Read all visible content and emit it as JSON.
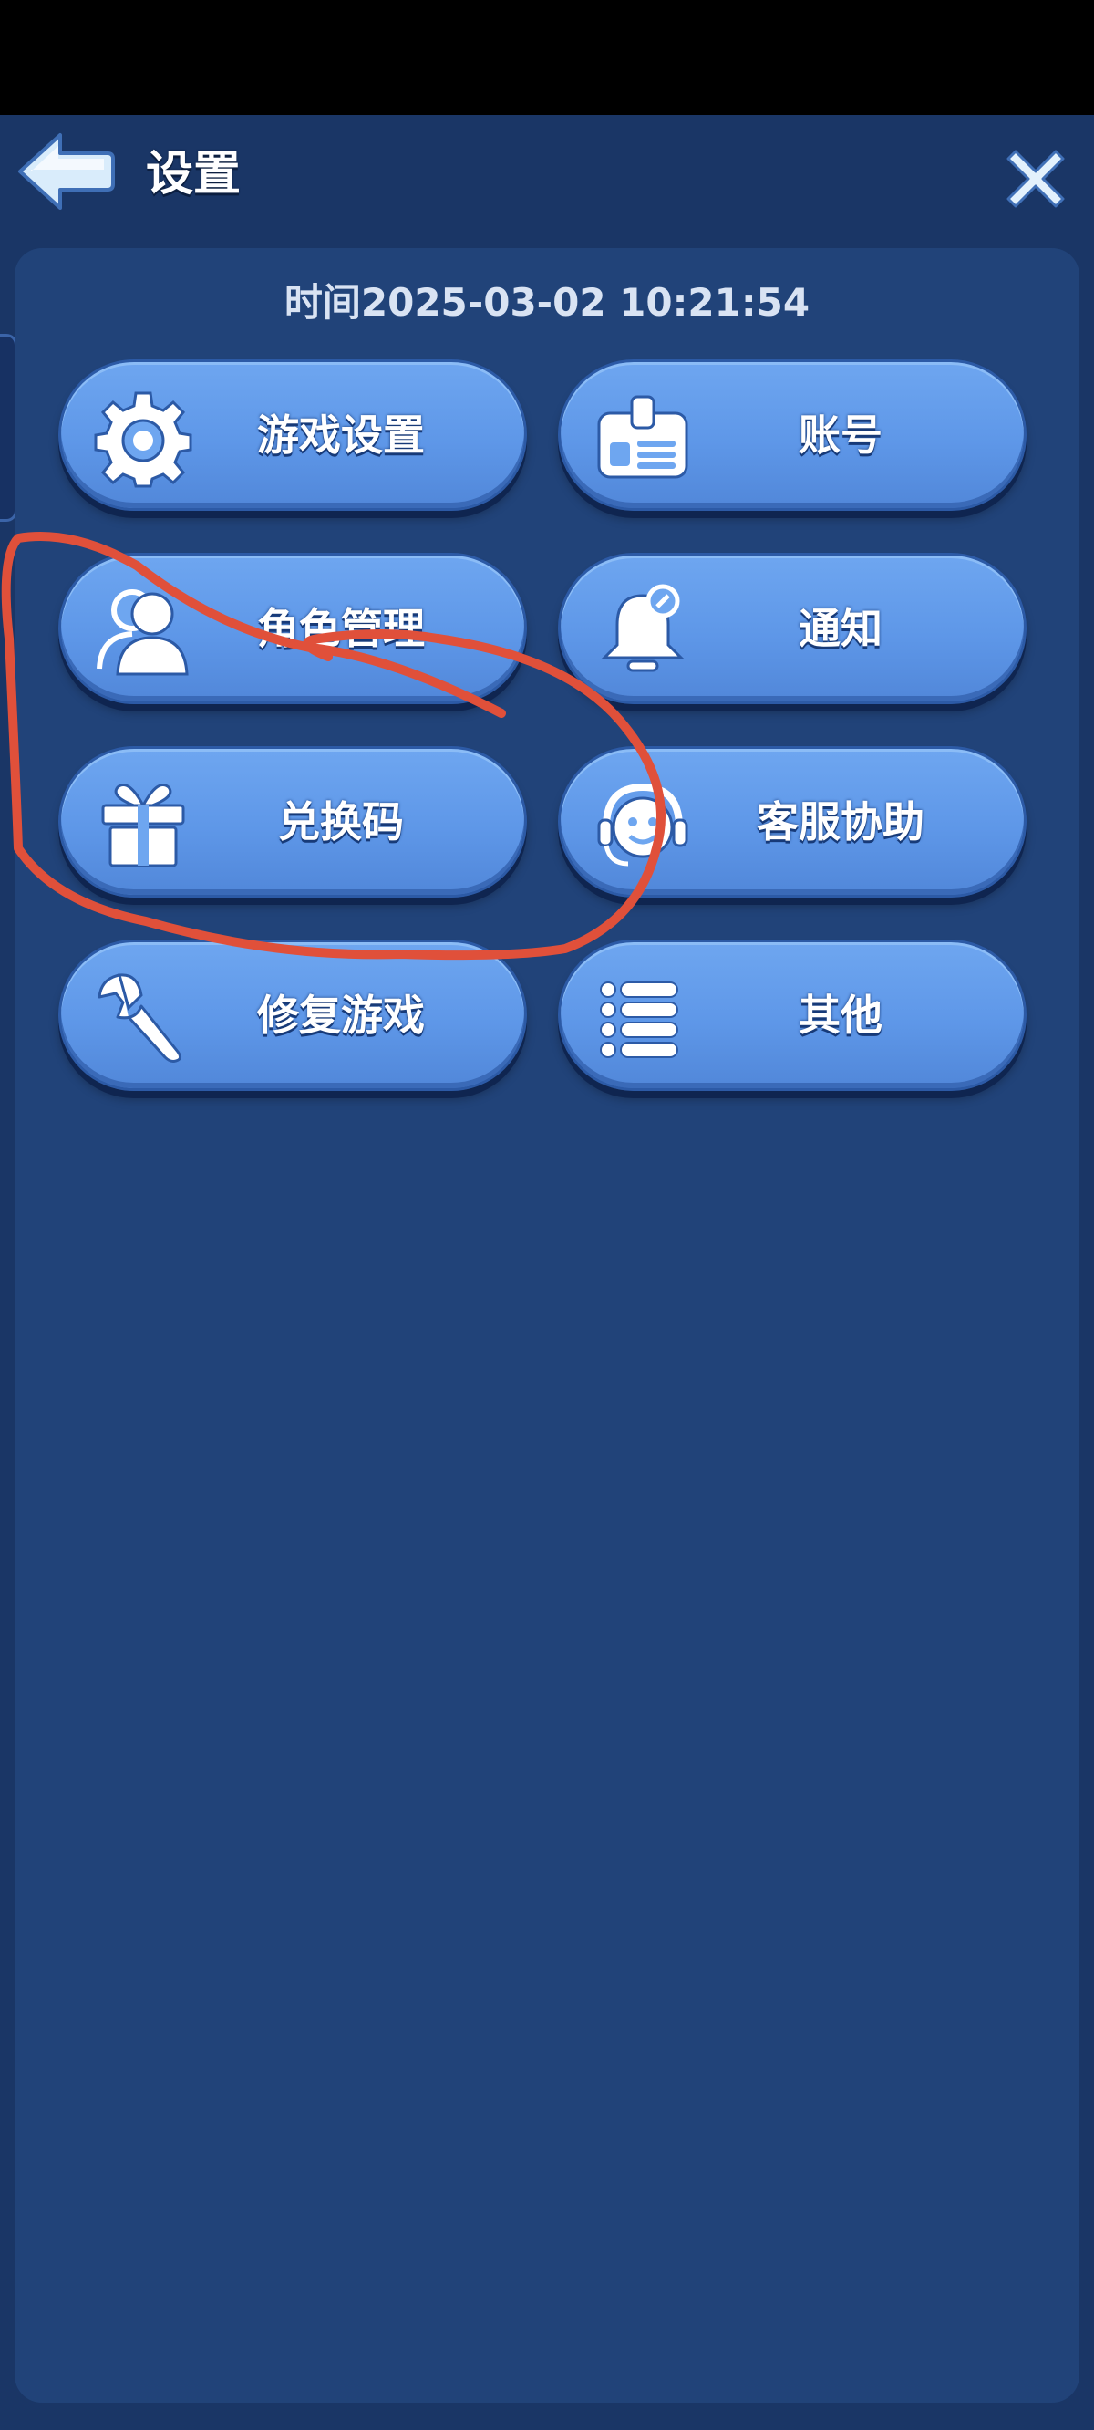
{
  "header": {
    "title": "设置"
  },
  "panel": {
    "time": "时间2025-03-02 10:21:54"
  },
  "menu": {
    "items": [
      {
        "label": "游戏设置",
        "icon": "gear-icon"
      },
      {
        "label": "账号",
        "icon": "id-card-icon"
      },
      {
        "label": "角色管理",
        "icon": "users-icon"
      },
      {
        "label": "通知",
        "icon": "bell-icon"
      },
      {
        "label": "兑换码",
        "icon": "gift-icon"
      },
      {
        "label": "客服协助",
        "icon": "headset-icon"
      },
      {
        "label": "修复游戏",
        "icon": "wrench-icon"
      },
      {
        "label": "其他",
        "icon": "list-icon"
      }
    ]
  },
  "colors": {
    "background": "#1a3666",
    "panel": "#214379",
    "button": "#6ea6f0",
    "annotation": "#e0503a"
  }
}
